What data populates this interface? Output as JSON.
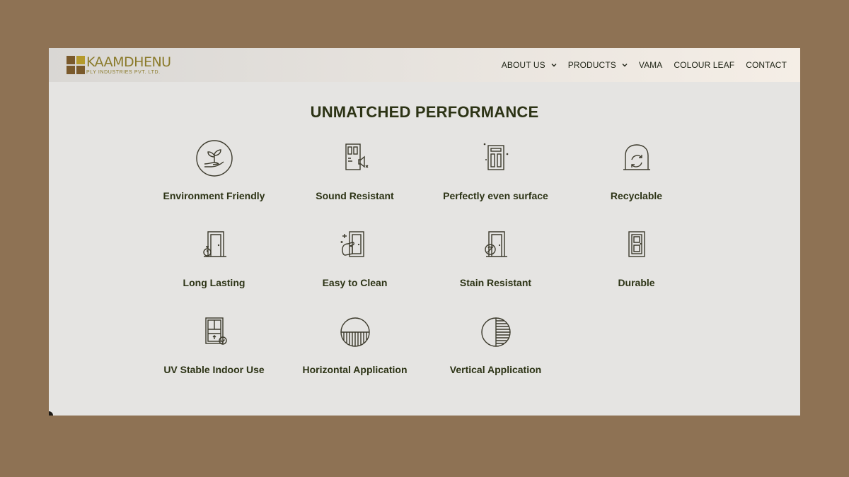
{
  "brand": {
    "name": "KAAMDHENU",
    "subtitle": "PLY INDUSTRIES PVT. LTD."
  },
  "nav": {
    "items": [
      {
        "label": "ABOUT US",
        "has_dropdown": true
      },
      {
        "label": "PRODUCTS",
        "has_dropdown": true
      },
      {
        "label": "VAMA",
        "has_dropdown": false
      },
      {
        "label": "COLOUR LEAF",
        "has_dropdown": false
      },
      {
        "label": "CONTACT",
        "has_dropdown": false
      }
    ]
  },
  "section": {
    "title": "UNMATCHED PERFORMANCE"
  },
  "features": [
    {
      "label": "Environment Friendly",
      "icon": "plant-in-hand-icon"
    },
    {
      "label": "Sound Resistant",
      "icon": "door-sound-mute-icon"
    },
    {
      "label": "Perfectly even surface",
      "icon": "sparkling-door-icon"
    },
    {
      "label": "Recyclable",
      "icon": "recycle-arch-icon"
    },
    {
      "label": "Long Lasting",
      "icon": "door-stopwatch-icon"
    },
    {
      "label": "Easy to Clean",
      "icon": "door-wipe-icon"
    },
    {
      "label": "Stain Resistant",
      "icon": "door-stain-icon"
    },
    {
      "label": "Durable",
      "icon": "door-panel-icon"
    },
    {
      "label": "UV Stable Indoor Use",
      "icon": "window-check-icon"
    },
    {
      "label": "Horizontal Application",
      "icon": "horizontal-lines-circle-icon"
    },
    {
      "label": "Vertical Application",
      "icon": "vertical-lines-circle-icon"
    }
  ],
  "colors": {
    "background": "#8e7254",
    "panel": "#e5e4e2",
    "text_dark": "#2c3315",
    "brand_gold": "#8a7a2a",
    "brand_brown": "#7a5a2c"
  }
}
